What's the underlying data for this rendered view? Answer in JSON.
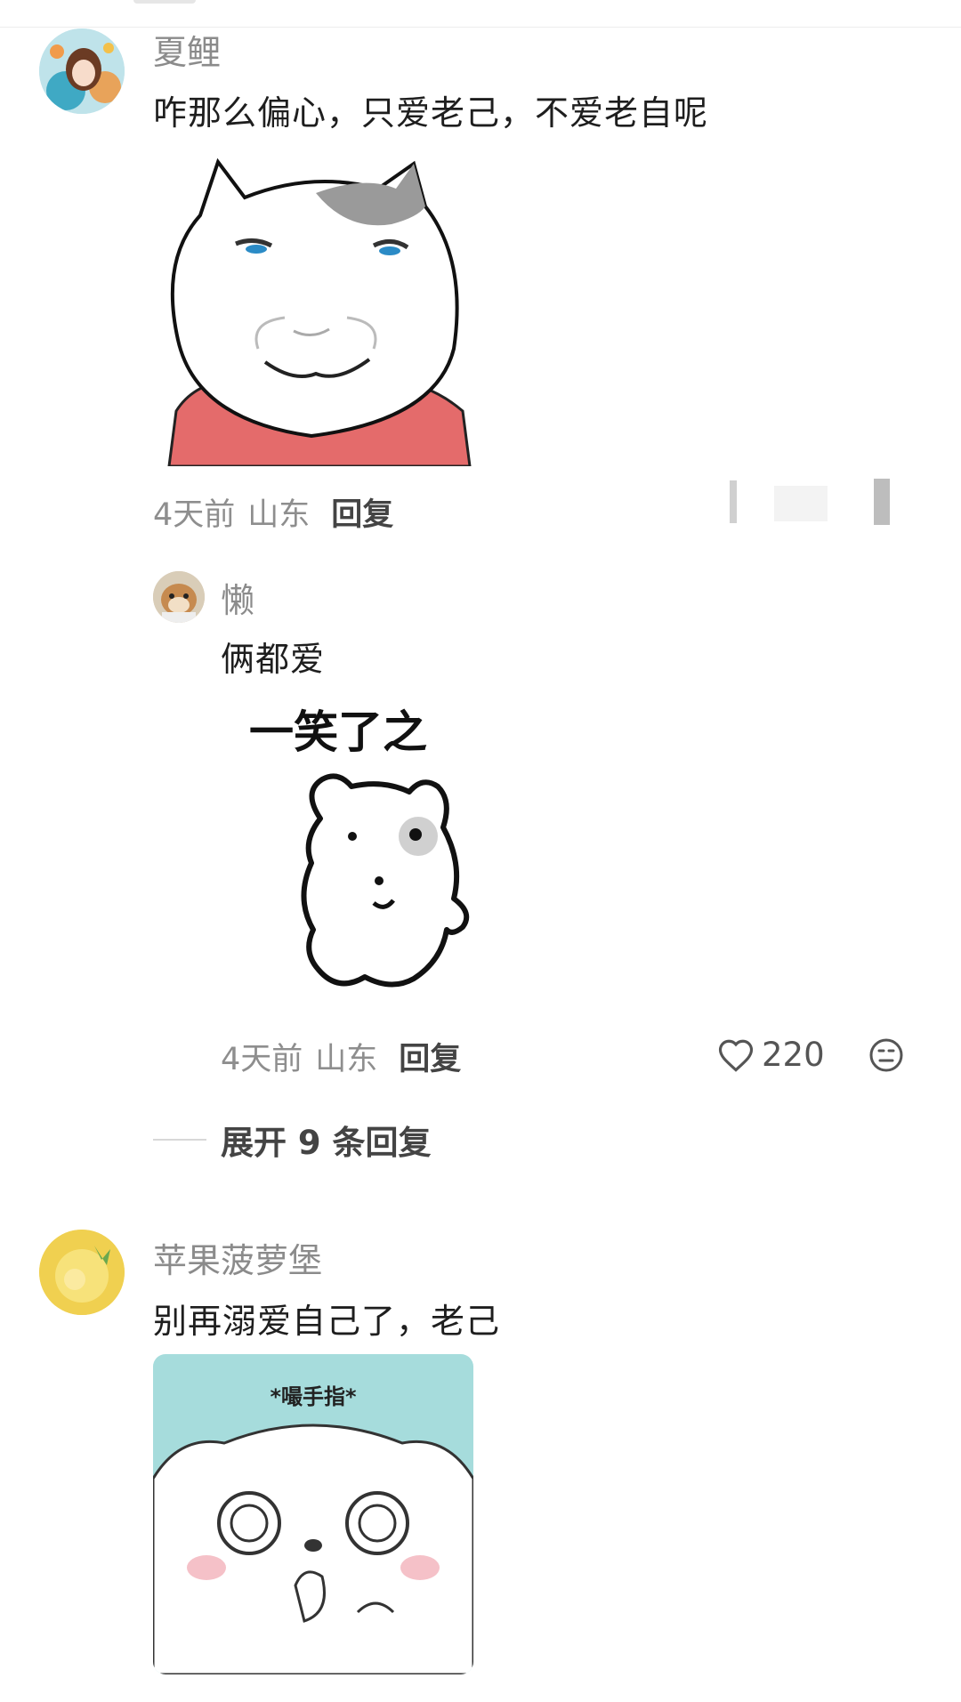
{
  "comments": [
    {
      "username": "夏鲤",
      "text": "咋那么偏心，只爱老己，不爱老自呢",
      "time": "4天前",
      "location": "山东",
      "reply_label": "回复",
      "avatar_icon": "anime-girl-avatar"
    },
    {
      "username": "懒",
      "text": "俩都爱",
      "sticker_caption": "一笑了之",
      "time": "4天前",
      "location": "山东",
      "reply_label": "回复",
      "like_count": "220",
      "avatar_icon": "hamster-avatar"
    },
    {
      "username": "苹果菠萝堡",
      "text": "别再溺爱自己了，老己",
      "sticker_caption": "*嘬手指*",
      "avatar_icon": "pineapple-avatar"
    }
  ],
  "expand_replies": "展开 9 条回复",
  "colors": {
    "sticker_red": "#e46b6b",
    "sticker_teal": "#a6dcdc",
    "sticker_gray": "#9a9a9a"
  }
}
